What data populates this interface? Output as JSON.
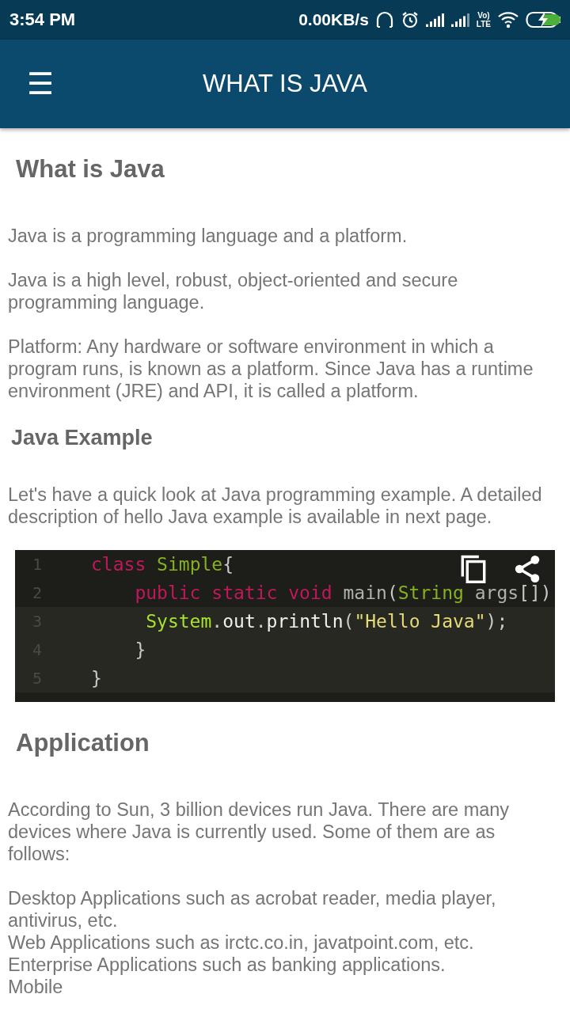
{
  "status_bar": {
    "time": "3:54 PM",
    "speed": "0.00KB/s",
    "volte": "Vo)",
    "lte": "LTE"
  },
  "app_bar": {
    "menu": "☰",
    "title": "WHAT IS JAVA"
  },
  "content": [
    {
      "kind": "heading",
      "text": "What is Java"
    },
    {
      "kind": "paragraph",
      "text": "Java is a programming language and a platform."
    },
    {
      "kind": "paragraph",
      "text": "Java is a high level, robust, object-oriented and secure programming language."
    },
    {
      "kind": "paragraph",
      "text": "Platform: Any hardware or software environment in which a program runs, is known as a platform. Since Java has a runtime environment (JRE) and API, it is called a platform."
    },
    {
      "kind": "subheading",
      "text": "Java Example"
    },
    {
      "kind": "paragraph",
      "text": "Let's have a quick look at Java programming example. A detailed description of hello Java example is available in next page."
    },
    {
      "kind": "code",
      "lines": [
        {
          "number": "1",
          "tokens": [
            {
              "kind": "keyword",
              "text": "class "
            },
            {
              "kind": "type",
              "text": "Simple"
            },
            {
              "kind": "punct",
              "text": "{"
            }
          ]
        },
        {
          "number": "2",
          "tokens": [
            {
              "kind": "keyword",
              "text": "    public static void"
            },
            {
              "kind": "plain",
              "text": " main"
            },
            {
              "kind": "punct",
              "text": "("
            },
            {
              "kind": "type",
              "text": "String"
            },
            {
              "kind": "plain",
              "text": " args"
            },
            {
              "kind": "punct",
              "text": "[])"
            }
          ]
        },
        {
          "number": "3",
          "tokens": [
            {
              "kind": "class",
              "text": "     System"
            },
            {
              "kind": "punct",
              "text": "."
            },
            {
              "kind": "bright",
              "text": "out"
            },
            {
              "kind": "punct",
              "text": "."
            },
            {
              "kind": "bright",
              "text": "println"
            },
            {
              "kind": "punct",
              "text": "("
            },
            {
              "kind": "string",
              "text": "\"Hello Java\""
            },
            {
              "kind": "punct",
              "text": ");"
            }
          ]
        },
        {
          "number": "4",
          "tokens": [
            {
              "kind": "punct",
              "text": "    }"
            }
          ]
        },
        {
          "number": "5",
          "tokens": [
            {
              "kind": "punct",
              "text": "}"
            }
          ]
        }
      ]
    },
    {
      "kind": "heading",
      "text": "Application"
    },
    {
      "kind": "paragraph",
      "text": "According to Sun, 3 billion devices run Java. There are many devices where Java is currently used. Some of them are as follows:"
    },
    {
      "kind": "paragraph",
      "text": "Desktop Applications such as acrobat reader, media player, antivirus, etc."
    },
    {
      "kind": "line",
      "text": "Web Applications such as irctc.co.in, javatpoint.com, etc."
    },
    {
      "kind": "line",
      "text": "Enterprise Applications such as banking applications."
    },
    {
      "kind": "line",
      "text": "Mobile"
    }
  ]
}
